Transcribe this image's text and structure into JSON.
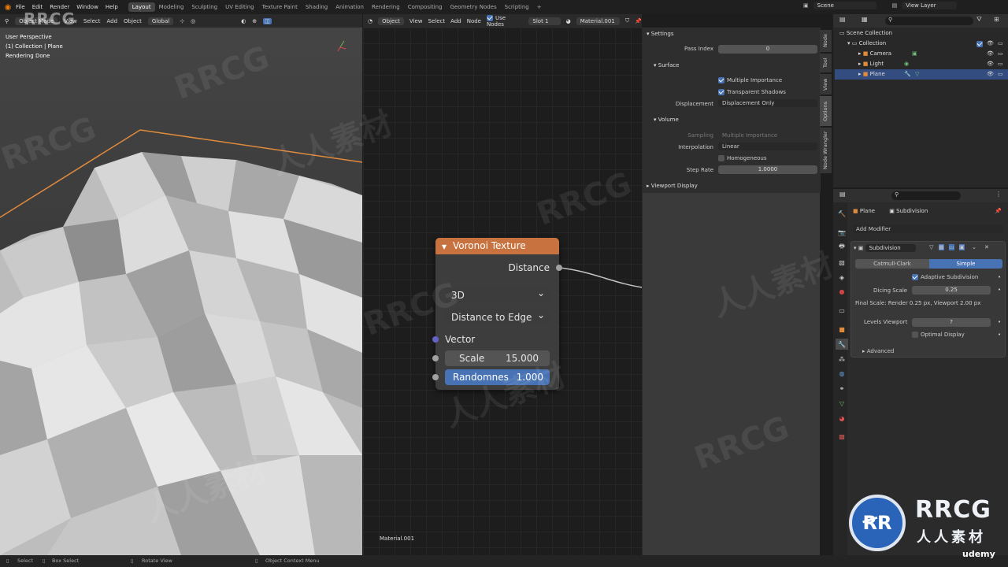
{
  "menu": [
    "File",
    "Edit",
    "Render",
    "Window",
    "Help"
  ],
  "workspaces": [
    "Layout",
    "Modeling",
    "Sculpting",
    "UV Editing",
    "Texture Paint",
    "Shading",
    "Animation",
    "Rendering",
    "Compositing",
    "Geometry Nodes",
    "Scripting"
  ],
  "workspace_plus": "+",
  "scene": {
    "label": "Scene",
    "viewlayer": "View Layer"
  },
  "viewport": {
    "mode": "Object Mode",
    "menu": [
      "View",
      "Select",
      "Add",
      "Object"
    ],
    "orientation": "Global",
    "info1": "User Perspective",
    "info2": "(1) Collection | Plane",
    "info3": "Rendering Done"
  },
  "node_header": {
    "mode": "Object",
    "menu": [
      "View",
      "Select",
      "Add",
      "Node"
    ],
    "use_nodes": "Use Nodes",
    "slot": "Slot 1",
    "material": "Material.001"
  },
  "voronoi": {
    "title": "Voronoi Texture",
    "out": "Distance",
    "dim": "3D",
    "feature": "Distance to Edge",
    "vector": "Vector",
    "scale_label": "Scale",
    "scale_value": "15.000",
    "rand_label": "Randomnes",
    "rand_value": "1.000"
  },
  "node_footer": "Material.001",
  "settings": {
    "title": "Settings",
    "pass_index_label": "Pass Index",
    "pass_index": "0",
    "surface": "Surface",
    "multi_importance": "Multiple Importance",
    "transparent_shadows": "Transparent Shadows",
    "displacement_label": "Displacement",
    "displacement": "Displacement Only",
    "volume": "Volume",
    "sampling_label": "Sampling",
    "sampling": "Multiple Importance",
    "interp_label": "Interpolation",
    "interp": "Linear",
    "homogeneous": "Homogeneous",
    "step_label": "Step Rate",
    "step": "1.0000",
    "viewport_display": "Viewport Display"
  },
  "side_tabs": [
    "Node",
    "Tool",
    "View",
    "Options",
    "Node Wrangler"
  ],
  "outliner": {
    "root": "Scene Collection",
    "collection": "Collection",
    "items": [
      "Camera",
      "Light",
      "Plane"
    ]
  },
  "properties": {
    "object": "Plane",
    "modifier_name": "Subdivision",
    "add_modifier": "Add Modifier",
    "mod_title": "Subdivision",
    "catmull": "Catmull-Clark",
    "simple": "Simple",
    "adaptive": "Adaptive Subdivision",
    "dicing_label": "Dicing Scale",
    "dicing": "0.25",
    "final_scale": "Final Scale: Render 0.25 px, Viewport 2.00 px",
    "levels_label": "Levels Viewport",
    "levels": "?",
    "optimal": "Optimal Display",
    "advanced": "Advanced"
  },
  "status": {
    "select": "Select",
    "box": "Box Select",
    "rotate": "Rotate View",
    "context": "Object Context Menu"
  },
  "watermark": {
    "logo": "RRCG",
    "sub": "人人素材",
    "brand": "udemy"
  },
  "colors": {
    "accent": "#4772b3",
    "node_header": "#c8733f",
    "outline": "#e08a3c"
  }
}
